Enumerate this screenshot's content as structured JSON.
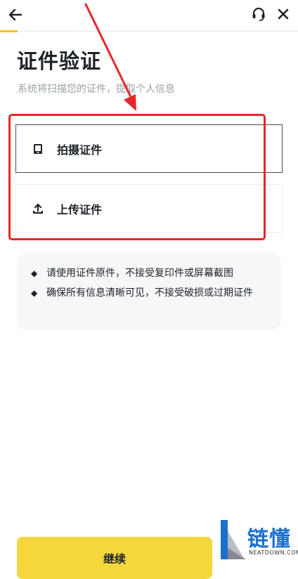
{
  "header": {
    "back_icon": "arrow-left-icon",
    "support_icon": "headset-icon",
    "close_icon": "close-icon",
    "progress": 0.06,
    "accent_color": "#f0c419"
  },
  "main": {
    "title": "证件验证",
    "subtitle": "系统将扫描您的证件，提取个人信息",
    "options": [
      {
        "label": "拍摄证件",
        "icon": "phone-camera-icon"
      },
      {
        "label": "上传证件",
        "icon": "upload-icon"
      }
    ],
    "tips": [
      "请使用证件原件，不接受复印件或屏幕截图",
      "确保所有信息清晰可见，不接受破损或过期证件"
    ],
    "tip_bullet": "◆"
  },
  "footer": {
    "continue_label": "继续"
  },
  "watermark": {
    "text": "链懂",
    "sub": "NEATDOWN.COM"
  },
  "annotation": {
    "highlight_color": "#e8262a"
  }
}
